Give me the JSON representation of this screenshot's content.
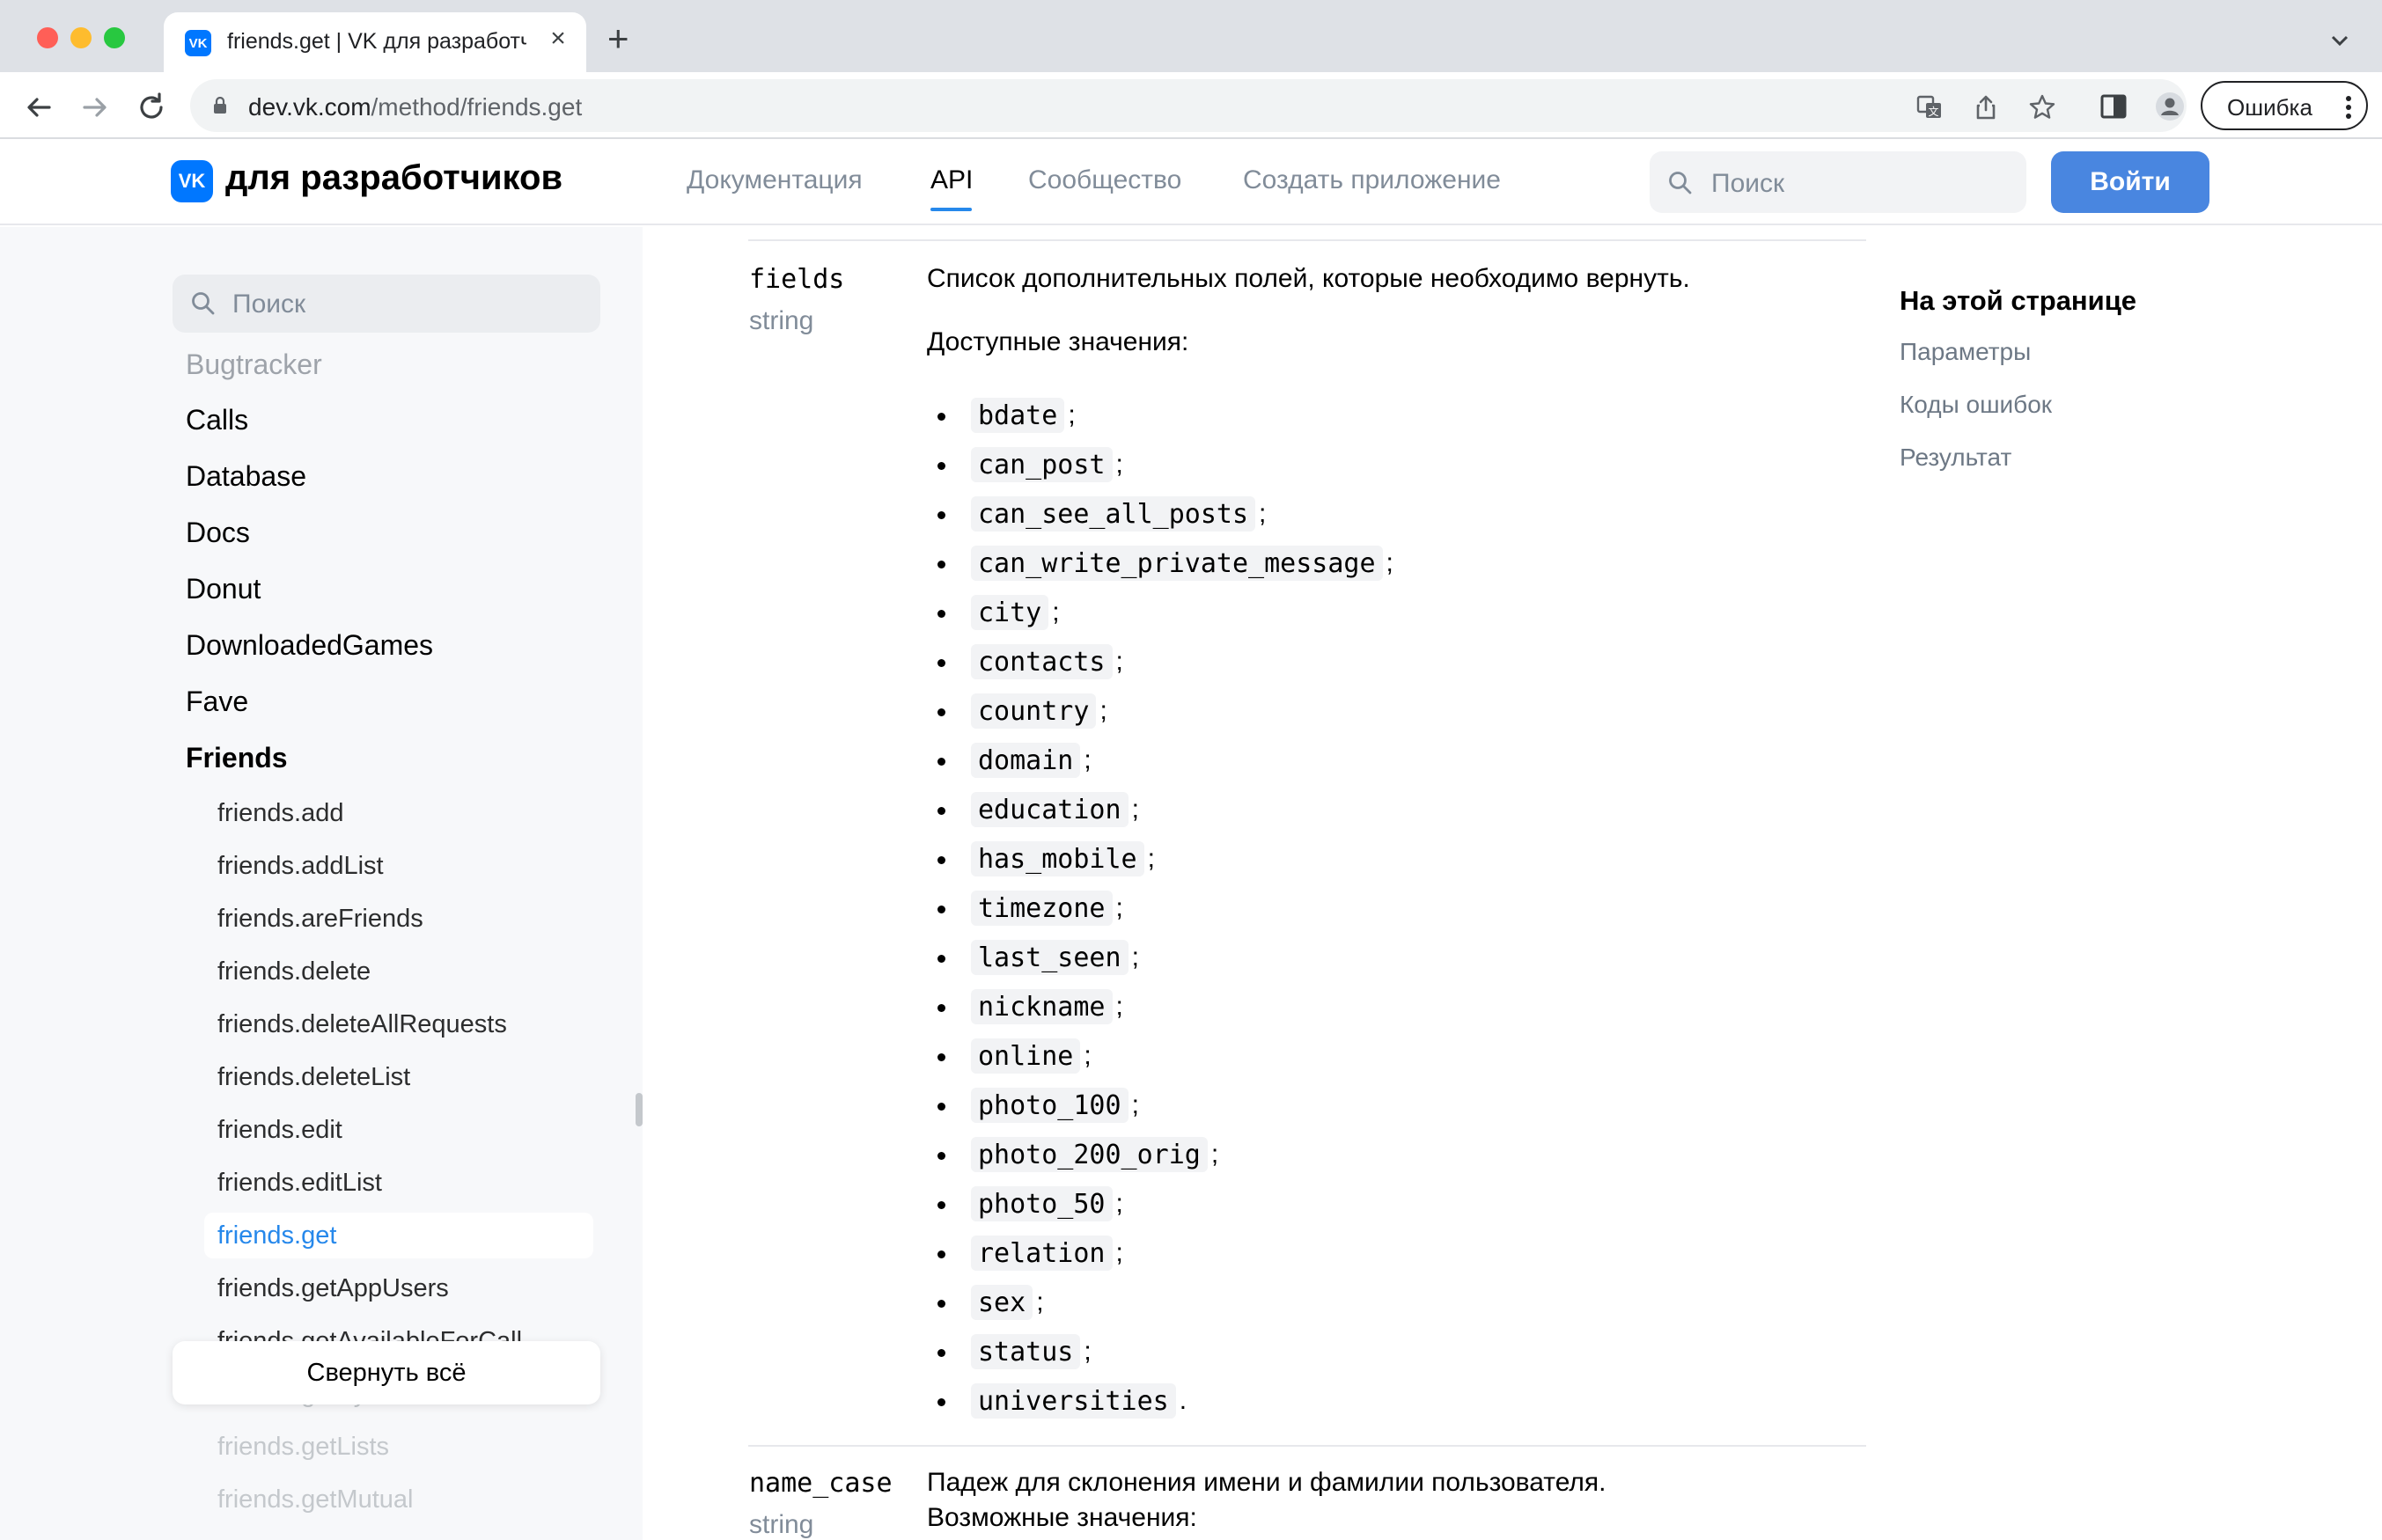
{
  "browser": {
    "tab_title": "friends.get | VK для разработчиков",
    "tab_favicon": "VK",
    "new_tab": "+",
    "close": "×",
    "url_host": "dev.vk.com",
    "url_path": "/method/friends.get",
    "profile_label": "Ошибка"
  },
  "header": {
    "logo_mark": "VK",
    "logo_text": "для разработчиков",
    "nav": [
      "Документация",
      "API",
      "Сообщество",
      "Создать приложение"
    ],
    "active_nav": "API",
    "search_placeholder": "Поиск",
    "login_label": "Войти"
  },
  "sidebar": {
    "search_placeholder": "Поиск",
    "sections": [
      "Bugtracker",
      "Calls",
      "Database",
      "Docs",
      "Donut",
      "DownloadedGames",
      "Fave",
      "Friends"
    ],
    "friends_methods": [
      "friends.add",
      "friends.addList",
      "friends.areFriends",
      "friends.delete",
      "friends.deleteAllRequests",
      "friends.deleteList",
      "friends.edit",
      "friends.editList",
      "friends.get",
      "friends.getAppUsers",
      "friends.getAvailableForCall",
      "friends.getByPhones",
      "friends.getLists",
      "friends.getMutual"
    ],
    "active_method": "friends.get",
    "collapse_label": "Свернуть всё"
  },
  "content": {
    "params": [
      {
        "name": "fields",
        "type": "string",
        "description": "Список дополнительных полей, которые необходимо вернуть.",
        "values_label": "Доступные значения:",
        "values": [
          "bdate",
          "can_post",
          "can_see_all_posts",
          "can_write_private_message",
          "city",
          "contacts",
          "country",
          "domain",
          "education",
          "has_mobile",
          "timezone",
          "last_seen",
          "nickname",
          "online",
          "photo_100",
          "photo_200_orig",
          "photo_50",
          "relation",
          "sex",
          "status",
          "universities"
        ],
        "separator": ";",
        "last_separator": "."
      },
      {
        "name": "name_case",
        "type": "string",
        "description": "Падеж для склонения имени и фамилии пользователя.",
        "values_label": "Возможные значения:"
      }
    ]
  },
  "toc": {
    "title": "На этой странице",
    "links": [
      "Параметры",
      "Коды ошибок",
      "Результат"
    ]
  }
}
